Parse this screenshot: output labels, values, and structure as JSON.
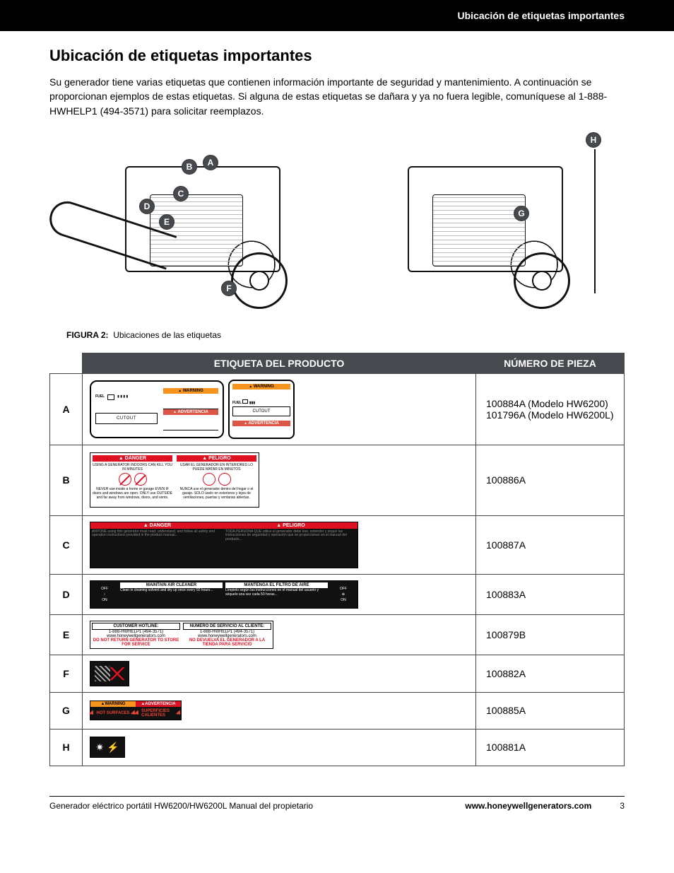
{
  "header": {
    "title": "Ubicación de etiquetas importantes"
  },
  "main": {
    "heading": "Ubicación de etiquetas importantes",
    "intro": "Su generador tiene varias etiquetas que contienen información importante de seguridad y mantenimiento. A continuación se proporcionan ejemplos de estas etiquetas. Si alguna de estas etiquetas se dañara y ya no fuera legible, comuníquese al 1-888-HWHELP1 (494-3571) para solicitar reemplazos."
  },
  "figure": {
    "label": "FIGURA 2:",
    "caption": "Ubicaciones de las etiquetas",
    "callouts_left": [
      "A",
      "B",
      "C",
      "D",
      "E",
      "F"
    ],
    "callouts_right": [
      "G",
      "H"
    ]
  },
  "table": {
    "header_product": "ETIQUETA DEL PRODUCTO",
    "header_part": "NÚMERO DE PIEZA",
    "rows": [
      {
        "letter": "A",
        "part": "100884A (Modelo HW6200)\n101796A (Modelo HW6200L)",
        "label_text": {
          "fuel": "FUEL",
          "cutout": "CUTOUT",
          "warning": "WARNING",
          "advertencia": "ADVERTENCIA"
        }
      },
      {
        "letter": "B",
        "part": "100886A",
        "label_text": {
          "danger": "DANGER",
          "peligro": "PELIGRO"
        }
      },
      {
        "letter": "C",
        "part": "100887A",
        "label_text": {
          "danger": "DANGER",
          "peligro": "PELIGRO"
        }
      },
      {
        "letter": "D",
        "part": "100883A",
        "label_text": {
          "maintain": "MAINTAIN AIR CLEANER",
          "mantenga": "MANTENGA EL FILTRO DE AIRE",
          "off": "OFF",
          "on": "ON"
        }
      },
      {
        "letter": "E",
        "part": "100879B",
        "label_text": {
          "hotline_en": "CUSTOMER HOTLINE:",
          "hotline_es": "NUMERO DE SERVICIO AL CLIENTE:",
          "phone": "1-888-HWHELP1 (494-3571)",
          "url": "www.honeywellgenerators.com",
          "noreturn_en": "DO NOT RETURN GENERATOR TO STORE FOR SERVICE",
          "noreturn_es": "NO DEVUELVA EL GENERADOR A LA TIENDA PARA SERVICIO"
        }
      },
      {
        "letter": "F",
        "part": "100882A"
      },
      {
        "letter": "G",
        "part": "100885A",
        "label_text": {
          "warning": "WARNING",
          "advertencia": "ADVERTENCIA",
          "hot_en": "HOT SURFACES",
          "hot_es": "SUPERFICIES CALIENTES"
        }
      },
      {
        "letter": "H",
        "part": "100881A"
      }
    ]
  },
  "footer": {
    "left": "Generador eléctrico portátil HW6200/HW6200L Manual del propietario",
    "url": "www.honeywellgenerators.com",
    "page": "3"
  }
}
